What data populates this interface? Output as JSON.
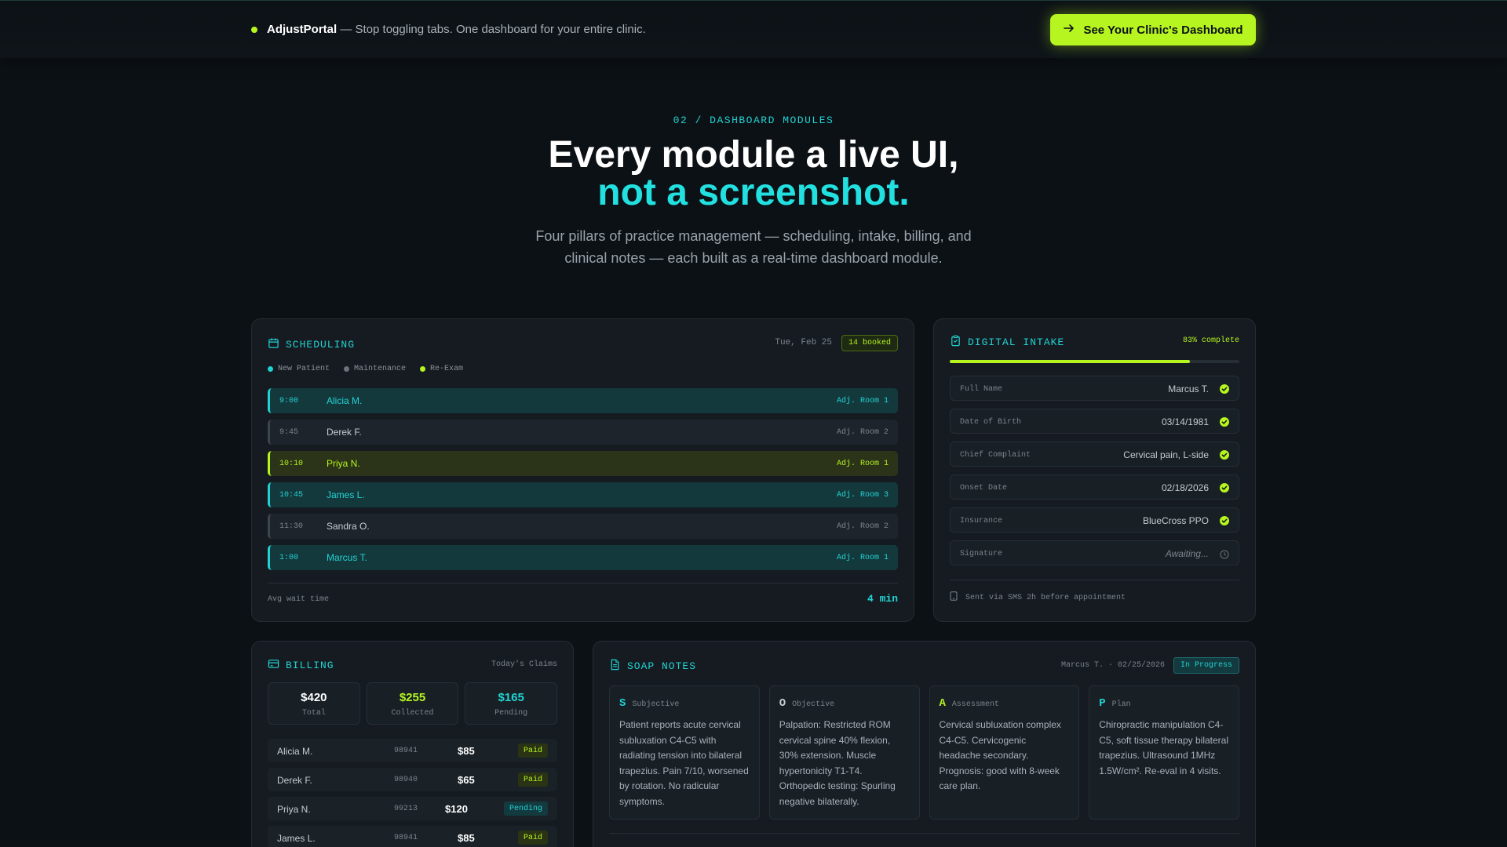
{
  "topbar": {
    "brand_name": "AdjustPortal",
    "tagline": "— Stop toggling tabs. One dashboard for your entire clinic.",
    "cta_label": "See Your Clinic's Dashboard"
  },
  "hero": {
    "eyebrow": "02 / DASHBOARD MODULES",
    "title_line1": "Every module a live UI,",
    "title_line2": "not a screenshot.",
    "subtitle": "Four pillars of practice management — scheduling, intake, billing, and clinical notes — each built as a real-time dashboard module."
  },
  "scheduling": {
    "title": "SCHEDULING",
    "date": "Tue, Feb 25",
    "booked": "14 booked",
    "legend": [
      {
        "label": "New Patient",
        "color": "#22d3d3"
      },
      {
        "label": "Maintenance",
        "color": "#6b737a"
      },
      {
        "label": "Re-Exam",
        "color": "#b6f520"
      }
    ],
    "appointments": [
      {
        "time": "9:00",
        "name": "Alicia M.",
        "room": "Adj. Room 1",
        "type": "new"
      },
      {
        "time": "9:45",
        "name": "Derek F.",
        "room": "Adj. Room 2",
        "type": "maint"
      },
      {
        "time": "10:10",
        "name": "Priya N.",
        "room": "Adj. Room 1",
        "type": "reexam"
      },
      {
        "time": "10:45",
        "name": "James L.",
        "room": "Adj. Room 3",
        "type": "new"
      },
      {
        "time": "11:30",
        "name": "Sandra O.",
        "room": "Adj. Room 2",
        "type": "maint"
      },
      {
        "time": "1:00",
        "name": "Marcus T.",
        "room": "Adj. Room 1",
        "type": "new"
      }
    ],
    "wait_label": "Avg wait time",
    "wait_value": "4 min"
  },
  "intake": {
    "title": "DIGITAL INTAKE",
    "progress_label": "83% complete",
    "progress": 0.83,
    "fields": [
      {
        "label": "Full Name",
        "value": "Marcus T.",
        "done": true
      },
      {
        "label": "Date of Birth",
        "value": "03/14/1981",
        "done": true
      },
      {
        "label": "Chief Complaint",
        "value": "Cervical pain, L-side",
        "done": true
      },
      {
        "label": "Onset Date",
        "value": "02/18/2026",
        "done": true
      },
      {
        "label": "Insurance",
        "value": "BlueCross PPO",
        "done": true
      },
      {
        "label": "Signature",
        "value": "Awaiting...",
        "done": false
      }
    ],
    "footer": "Sent via SMS 2h before appointment"
  },
  "billing": {
    "title": "BILLING",
    "claims_label": "Today's Claims",
    "stats": [
      {
        "value": "$420",
        "label": "Total",
        "color": "#ffffff"
      },
      {
        "value": "$255",
        "label": "Collected",
        "color": "#b6f520"
      },
      {
        "value": "$165",
        "label": "Pending",
        "color": "#22d3d3"
      }
    ],
    "rows": [
      {
        "name": "Alicia M.",
        "code": "98941",
        "amount": "$85",
        "status": "Paid"
      },
      {
        "name": "Derek F.",
        "code": "98940",
        "amount": "$65",
        "status": "Paid"
      },
      {
        "name": "Priya N.",
        "code": "99213",
        "amount": "$120",
        "status": "Pending"
      },
      {
        "name": "James L.",
        "code": "98941",
        "amount": "$85",
        "status": "Paid"
      }
    ]
  },
  "soap": {
    "title": "SOAP NOTES",
    "meta": "Marcus T. · 02/25/2026",
    "status": "In Progress",
    "sections": [
      {
        "letter": "S",
        "label": "Subjective",
        "color": "#22d3d3",
        "text": "Patient reports acute cervical subluxation C4-C5 with radiating tension into bilateral trapezius. Pain 7/10, worsened by rotation. No radicular symptoms."
      },
      {
        "letter": "O",
        "label": "Objective",
        "color": "#c7ccd1",
        "text": "Palpation: Restricted ROM cervical spine 40% flexion, 30% extension. Muscle hypertonicity T1-T4. Orthopedic testing: Spurling negative bilaterally."
      },
      {
        "letter": "A",
        "label": "Assessment",
        "color": "#b6f520",
        "text": "Cervical subluxation complex C4-C5. Cervicogenic headache secondary. Prognosis: good with 8-week care plan."
      },
      {
        "letter": "P",
        "label": "Plan",
        "color": "#22d3d3",
        "text": "Chiropractic manipulation C4-C5, soft tissue therapy bilateral trapezius. Ultrasound 1MHz 1.5W/cm². Re-eval in 4 visits."
      }
    ]
  }
}
